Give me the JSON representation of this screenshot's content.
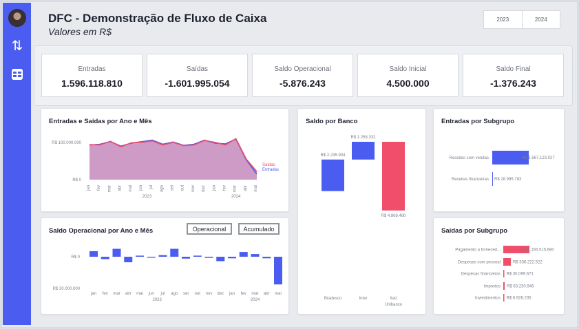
{
  "header": {
    "title": "DFC - Demonstração de Fluxo de Caixa",
    "subtitle": "Valores em R$"
  },
  "year_filter": [
    "2023",
    "2024"
  ],
  "sidebar": {
    "icons": [
      "avatar",
      "arrows-up-down-icon",
      "table-icon"
    ]
  },
  "kpis": [
    {
      "label": "Entradas",
      "value": "1.596.118.810"
    },
    {
      "label": "Saídas",
      "value": "-1.601.995.054"
    },
    {
      "label": "Saldo Operacional",
      "value": "-5.876.243"
    },
    {
      "label": "Saldo Inicial",
      "value": "4.500.000"
    },
    {
      "label": "Saldo Final",
      "value": "-1.376.243"
    }
  ],
  "colors": {
    "blue": "#4a5df0",
    "red": "#f04e6a",
    "area": "#c98fc0"
  },
  "charts": {
    "entradas_saidas": {
      "title": "Entradas e Saídas por Ano e Mês",
      "y_ticks": [
        "R$ 100.000.000",
        "R$ 0"
      ],
      "months": [
        "jan",
        "fev",
        "mar",
        "abr",
        "mai",
        "jun",
        "jul",
        "ago",
        "set",
        "out",
        "nov",
        "dez",
        "jan",
        "fev",
        "mar",
        "abr",
        "mai"
      ],
      "years": [
        "2023",
        "2024"
      ],
      "legend": [
        "Saídas",
        "Entradas"
      ]
    },
    "saldo_operacional": {
      "title": "Saldo Operacional por Ano e Mês",
      "buttons": [
        "Operacional",
        "Acumulado"
      ],
      "y_ticks": [
        "R$ 0",
        "R$ 20.000.000"
      ],
      "months": [
        "jan",
        "fev",
        "mar",
        "abr",
        "mai",
        "jun",
        "jul",
        "ago",
        "set",
        "out",
        "nov",
        "dez",
        "jan",
        "fev",
        "mar",
        "abr",
        "mai"
      ],
      "years": [
        "2023",
        "2024"
      ]
    },
    "saldo_banco": {
      "title": "Saldo por Banco",
      "labels": [
        "R$ 2.235.904",
        "R$ 1.258.332",
        "R$ 4.868.480"
      ],
      "categories": [
        "Bradesco",
        "Inter",
        "Itaú Unibanco"
      ]
    },
    "entradas_subgrupo": {
      "title": "Entradas por Subgrupo",
      "categories": [
        "Receitas com vendas",
        "Receitas financeiras"
      ],
      "labels": [
        "R$ 1.567.123.027",
        "R$ 28.995.783"
      ]
    },
    "saidas_subgrupo": {
      "title": "Saídas por Subgrupo",
      "categories": [
        "Pagamento a forneced...",
        "Despesas com pessoal",
        "Despesas financeiras",
        "Impostos",
        "Investimentos"
      ],
      "labels": [
        "R$ 1.165.515.680",
        "R$ 336.222.522",
        "R$ 30.099.671",
        "R$ 63.230.946",
        "R$ 6.926.235"
      ]
    }
  },
  "chart_data": [
    {
      "type": "area",
      "title": "Entradas e Saídas por Ano e Mês",
      "x": [
        "jan 2023",
        "fev 2023",
        "mar 2023",
        "abr 2023",
        "mai 2023",
        "jun 2023",
        "jul 2023",
        "ago 2023",
        "set 2023",
        "out 2023",
        "nov 2023",
        "dez 2023",
        "jan 2024",
        "fev 2024",
        "mar 2024",
        "abr 2024",
        "mai 2024"
      ],
      "ylim": [
        0,
        120000000
      ],
      "series": [
        {
          "name": "Saídas",
          "values": [
            94000000,
            93000000,
            103000000,
            88000000,
            99000000,
            100000000,
            104000000,
            93000000,
            100000000,
            91000000,
            93000000,
            105000000,
            100000000,
            93000000,
            110000000,
            55000000,
            22000000
          ]
        },
        {
          "name": "Entradas",
          "values": [
            93000000,
            95000000,
            102000000,
            90000000,
            98000000,
            102000000,
            106000000,
            95000000,
            101000000,
            92000000,
            95000000,
            106000000,
            98000000,
            96000000,
            109000000,
            53000000,
            15000000
          ]
        }
      ]
    },
    {
      "type": "bar",
      "title": "Saldo Operacional por Ano e Mês",
      "categories": [
        "jan 2023",
        "fev 2023",
        "mar 2023",
        "abr 2023",
        "mai 2023",
        "jun 2023",
        "jul 2023",
        "ago 2023",
        "set 2023",
        "out 2023",
        "nov 2023",
        "dez 2023",
        "jan 2024",
        "fev 2024",
        "mar 2024",
        "abr 2024",
        "mai 2024"
      ],
      "values": [
        -3500000,
        1500000,
        -5000000,
        3500000,
        -700000,
        600000,
        -1000000,
        -5000000,
        1200000,
        -700000,
        700000,
        2800000,
        1000000,
        -3000000,
        -1700000,
        1000000,
        17500000
      ],
      "ylim": [
        -10000000,
        22000000
      ]
    },
    {
      "type": "bar",
      "title": "Saldo por Banco",
      "categories": [
        "Bradesco",
        "Inter",
        "Itaú Unibanco"
      ],
      "values": [
        2235904,
        1258332,
        -4868480
      ]
    },
    {
      "type": "bar",
      "title": "Entradas por Subgrupo",
      "categories": [
        "Receitas com vendas",
        "Receitas financeiras"
      ],
      "values": [
        1567123027,
        28995783
      ]
    },
    {
      "type": "bar",
      "title": "Saídas por Subgrupo",
      "categories": [
        "Pagamento a forneced...",
        "Despesas com pessoal",
        "Despesas financeiras",
        "Impostos",
        "Investimentos"
      ],
      "values": [
        1165515680,
        336222522,
        30099671,
        63230946,
        6926235
      ]
    }
  ]
}
